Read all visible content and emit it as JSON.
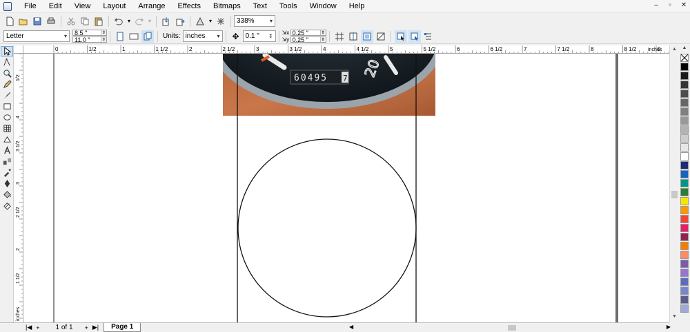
{
  "menubar": {
    "items": [
      "File",
      "Edit",
      "View",
      "Layout",
      "Arrange",
      "Effects",
      "Bitmaps",
      "Text",
      "Tools",
      "Window",
      "Help"
    ],
    "window_buttons": [
      "–",
      "▫",
      "✕"
    ]
  },
  "toolbar": {
    "zoom_value": "338%"
  },
  "property_bar": {
    "paper_size": "Letter",
    "width": "8.5 \"",
    "height": "11.0 \"",
    "units_label": "Units:",
    "units_value": "inches",
    "nudge": "0.1 \"",
    "duplicate_x": "0.25 \"",
    "duplicate_y": "0.25 \""
  },
  "rulers": {
    "h_labels": [
      "0",
      "1/2",
      "1",
      "1 1/2",
      "2",
      "2 1/2",
      "3",
      "3 1/2",
      "4",
      "4 1/2",
      "5",
      "5 1/2",
      "6",
      "6 1/2",
      "7",
      "7 1/2",
      "8",
      "8 1/2",
      "9",
      "inches"
    ],
    "v_labels": [
      "1/2",
      "4",
      "3 1/2",
      "3",
      "2 1/2",
      "2",
      "1 1/2",
      "inches"
    ]
  },
  "canvas": {
    "odometer_reading": "60495",
    "odometer_last": "7",
    "gauge_numeral": "20"
  },
  "page_nav": {
    "page_info": "1 of 1",
    "page_tab": "Page 1"
  },
  "palette": {
    "colors": [
      "#000000",
      "#1a1a1a",
      "#333333",
      "#4d4d4d",
      "#666666",
      "#808080",
      "#999999",
      "#b3b3b3",
      "#cccccc",
      "#e6e6e6",
      "#ffffff",
      "#1f2a7a",
      "#1565c0",
      "#009688",
      "#2e7d32",
      "#f7e600",
      "#ff9800",
      "#f44336",
      "#e91e63",
      "#8e244d",
      "#f57c00",
      "#ff8a65",
      "#7b5ea7",
      "#9575cd",
      "#5c6bc0",
      "#7986cb",
      "#5e5c8f",
      "#9fa8da"
    ]
  }
}
